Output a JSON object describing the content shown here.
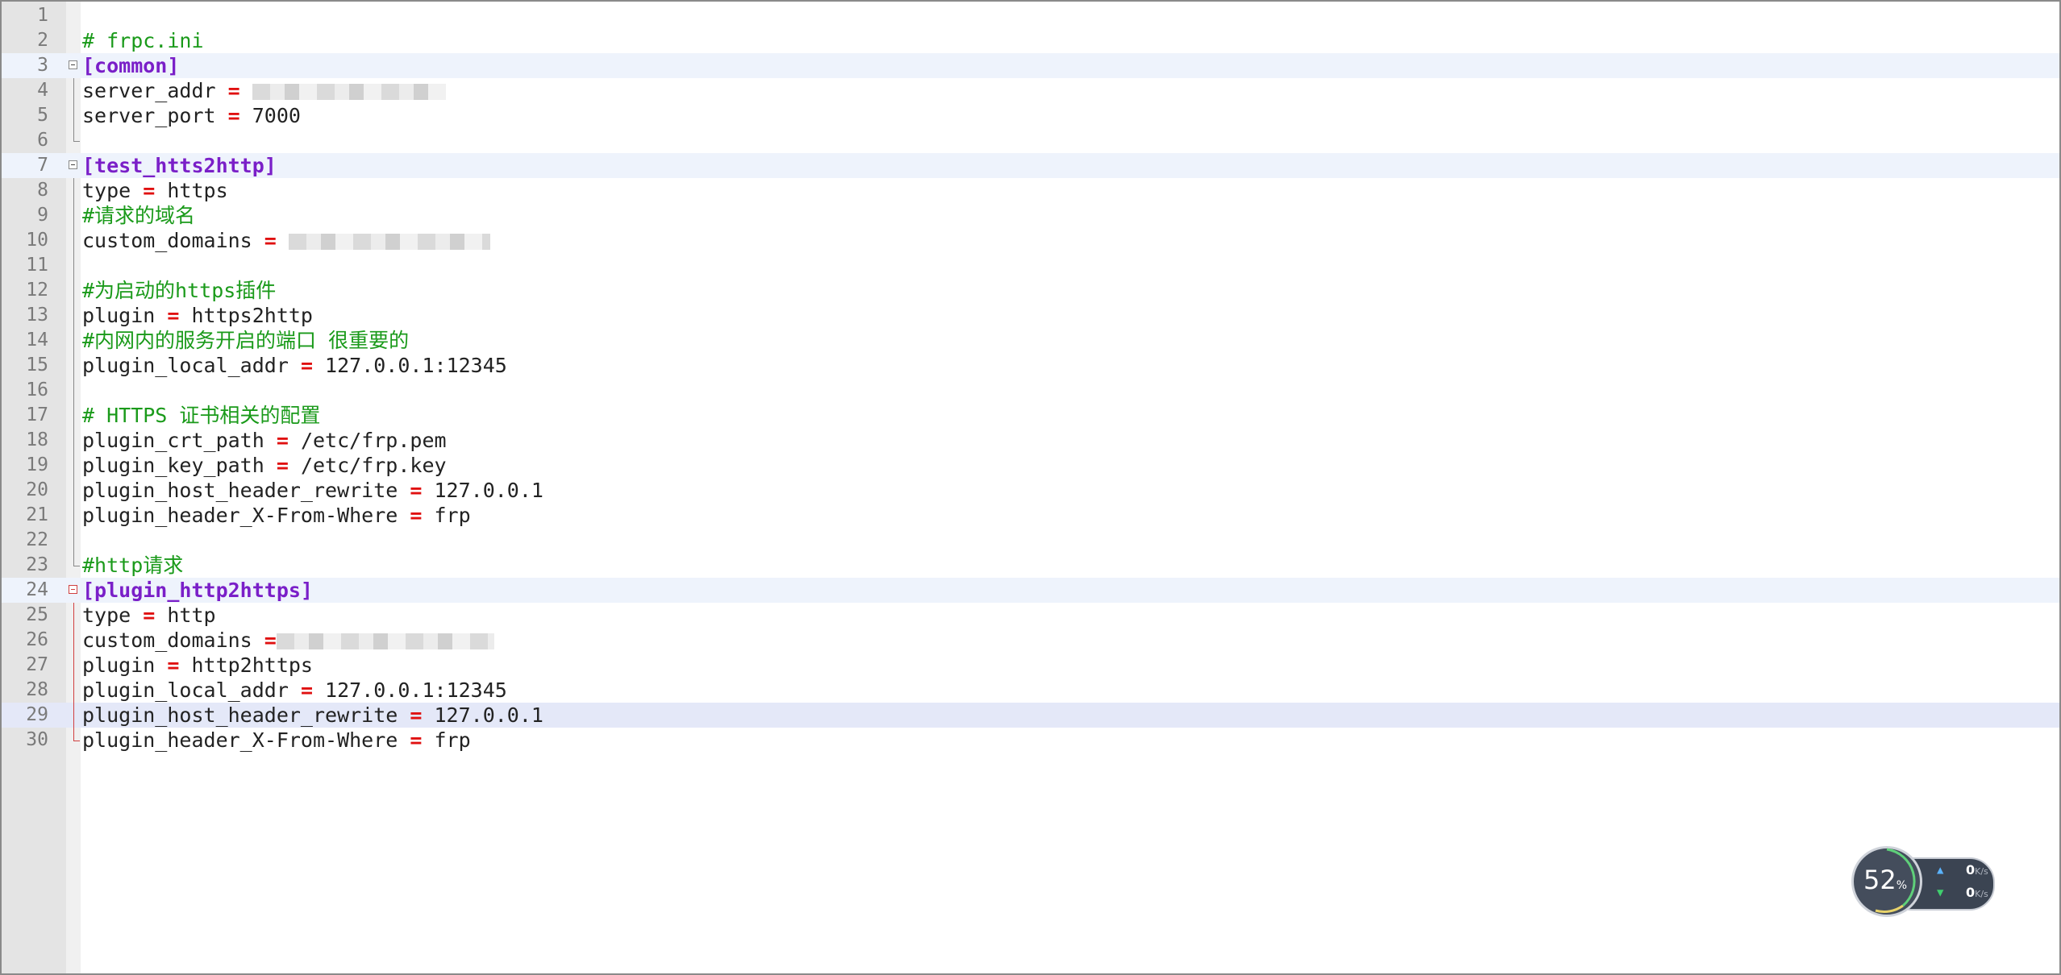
{
  "editor": {
    "colors": {
      "comment": "#1a9a1a",
      "section": "#7a1fc8",
      "operator": "#e01010",
      "text": "#222222"
    },
    "lines": [
      {
        "n": "1",
        "parts": []
      },
      {
        "n": "2",
        "parts": [
          {
            "t": "comment",
            "v": "# frpc.ini"
          }
        ]
      },
      {
        "n": "3",
        "fold": "box",
        "hl": "section",
        "parts": [
          {
            "t": "section",
            "v": "[common]"
          }
        ]
      },
      {
        "n": "4",
        "fold": "line",
        "parts": [
          {
            "t": "key",
            "v": "server_addr "
          },
          {
            "t": "eq",
            "v": "="
          },
          {
            "t": "val",
            "v": " "
          },
          {
            "t": "redact",
            "w": 240
          }
        ]
      },
      {
        "n": "5",
        "fold": "line",
        "parts": [
          {
            "t": "key",
            "v": "server_port "
          },
          {
            "t": "eq",
            "v": "="
          },
          {
            "t": "val",
            "v": " 7000"
          }
        ]
      },
      {
        "n": "6",
        "fold": "end",
        "parts": []
      },
      {
        "n": "7",
        "fold": "box",
        "hl": "section",
        "parts": [
          {
            "t": "section",
            "v": "[test_htts2http]"
          }
        ]
      },
      {
        "n": "8",
        "fold": "line",
        "parts": [
          {
            "t": "key",
            "v": "type "
          },
          {
            "t": "eq",
            "v": "="
          },
          {
            "t": "val",
            "v": " https"
          }
        ]
      },
      {
        "n": "9",
        "fold": "line",
        "parts": [
          {
            "t": "comment",
            "v": "#请求的域名"
          }
        ]
      },
      {
        "n": "10",
        "fold": "line",
        "parts": [
          {
            "t": "key",
            "v": "custom_domains "
          },
          {
            "t": "eq",
            "v": "="
          },
          {
            "t": "val",
            "v": " "
          },
          {
            "t": "redact",
            "w": 250
          }
        ]
      },
      {
        "n": "11",
        "fold": "line",
        "parts": []
      },
      {
        "n": "12",
        "fold": "line",
        "parts": [
          {
            "t": "comment",
            "v": "#为启动的https插件"
          }
        ]
      },
      {
        "n": "13",
        "fold": "line",
        "parts": [
          {
            "t": "key",
            "v": "plugin "
          },
          {
            "t": "eq",
            "v": "="
          },
          {
            "t": "val",
            "v": " https2http"
          }
        ]
      },
      {
        "n": "14",
        "fold": "line",
        "parts": [
          {
            "t": "comment",
            "v": "#内网内的服务开启的端口 很重要的"
          }
        ]
      },
      {
        "n": "15",
        "fold": "line",
        "parts": [
          {
            "t": "key",
            "v": "plugin_local_addr "
          },
          {
            "t": "eq",
            "v": "="
          },
          {
            "t": "val",
            "v": " 127.0.0.1:12345"
          }
        ]
      },
      {
        "n": "16",
        "fold": "line",
        "parts": []
      },
      {
        "n": "17",
        "fold": "line",
        "parts": [
          {
            "t": "comment",
            "v": "# HTTPS 证书相关的配置"
          }
        ]
      },
      {
        "n": "18",
        "fold": "line",
        "parts": [
          {
            "t": "key",
            "v": "plugin_crt_path "
          },
          {
            "t": "eq",
            "v": "="
          },
          {
            "t": "val",
            "v": " /etc/frp.pem"
          }
        ]
      },
      {
        "n": "19",
        "fold": "line",
        "parts": [
          {
            "t": "key",
            "v": "plugin_key_path "
          },
          {
            "t": "eq",
            "v": "="
          },
          {
            "t": "val",
            "v": " /etc/frp.key"
          }
        ]
      },
      {
        "n": "20",
        "fold": "line",
        "parts": [
          {
            "t": "key",
            "v": "plugin_host_header_rewrite "
          },
          {
            "t": "eq",
            "v": "="
          },
          {
            "t": "val",
            "v": " 127.0.0.1"
          }
        ]
      },
      {
        "n": "21",
        "fold": "line",
        "parts": [
          {
            "t": "key",
            "v": "plugin_header_X-From-Where "
          },
          {
            "t": "eq",
            "v": "="
          },
          {
            "t": "val",
            "v": " frp"
          }
        ]
      },
      {
        "n": "22",
        "fold": "line",
        "parts": []
      },
      {
        "n": "23",
        "fold": "end",
        "parts": [
          {
            "t": "comment",
            "v": "#http请求"
          }
        ]
      },
      {
        "n": "24",
        "fold": "box-red",
        "hl": "section",
        "parts": [
          {
            "t": "section",
            "v": "[plugin_http2https]"
          }
        ]
      },
      {
        "n": "25",
        "fold": "line-red",
        "parts": [
          {
            "t": "key",
            "v": "type "
          },
          {
            "t": "eq",
            "v": "="
          },
          {
            "t": "val",
            "v": " http"
          }
        ]
      },
      {
        "n": "26",
        "fold": "line-red",
        "parts": [
          {
            "t": "key",
            "v": "custom_domains "
          },
          {
            "t": "eq",
            "v": "="
          },
          {
            "t": "redact",
            "w": 270
          }
        ]
      },
      {
        "n": "27",
        "fold": "line-red",
        "parts": [
          {
            "t": "key",
            "v": "plugin "
          },
          {
            "t": "eq",
            "v": "="
          },
          {
            "t": "val",
            "v": " http2https"
          }
        ]
      },
      {
        "n": "28",
        "fold": "line-red",
        "parts": [
          {
            "t": "key",
            "v": "plugin_local_addr "
          },
          {
            "t": "eq",
            "v": "="
          },
          {
            "t": "val",
            "v": " 127.0.0.1:12345"
          }
        ]
      },
      {
        "n": "29",
        "fold": "line-red",
        "hl": "caret",
        "parts": [
          {
            "t": "key",
            "v": "plugin_host_header_rewrite "
          },
          {
            "t": "eq",
            "v": "="
          },
          {
            "t": "val",
            "v": " 127.0.0.1"
          }
        ]
      },
      {
        "n": "30",
        "fold": "end-red",
        "parts": [
          {
            "t": "key",
            "v": "plugin_header_X-From-Where "
          },
          {
            "t": "eq",
            "v": "="
          },
          {
            "t": "val",
            "v": " frp"
          }
        ]
      }
    ]
  },
  "net_widget": {
    "cpu_value": "52",
    "cpu_unit": "%",
    "upload_value": "0",
    "upload_unit": "K/s",
    "download_value": "0",
    "download_unit": "K/s",
    "upload_icon": "arrow-up-icon",
    "download_icon": "arrow-down-icon"
  }
}
